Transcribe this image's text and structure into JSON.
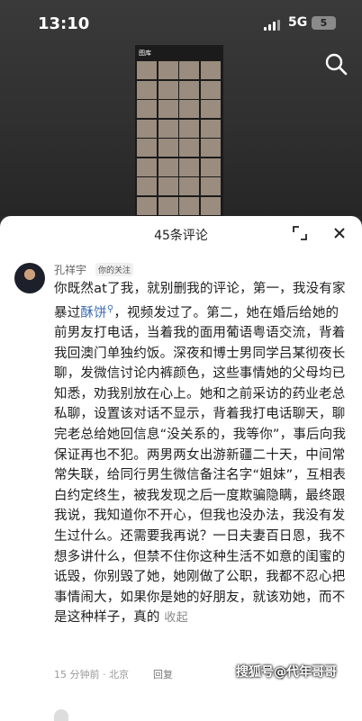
{
  "status_bar": {
    "time": "13:10",
    "network": "5G",
    "battery": "5"
  },
  "video": {
    "gallery_header": "图库"
  },
  "comments_sheet": {
    "title": "45条评论"
  },
  "comment": {
    "username": "孔祥宇",
    "relation_badge": "你的关注",
    "text_before_mention": "你既然at了我，就别删我的评论，第一，我没有家暴过",
    "mention": "酥饼",
    "text_after_mention": "，视频发过了。第二，她在婚后给她的前男友打电话，当着我的面用葡语粤语交流，背着我回澳门单独约饭。深夜和博士男同学吕某彻夜长聊，发微信讨论内裤颜色，这些事情她的父母均已知悉，劝我别放在心上。她和之前采访的药业老总私聊，设置该对话不显示，背着我打电话聊天，聊完老总给她回信息“没关系的，我等你”，事后向我保证再也不犯。两男两女出游新疆二十天，中间常常失联，给同行男生微信备注名字“姐妹”，互相表白约定终生，被我发现之后一度欺骗隐瞒，最终跟我说，我知道你不开心，但我也没办法，我没有发生过什么。还需要我再说？一日夫妻百日恩，我不想多讲什么，但禁不住你这种生活不如意的闺蜜的诋毁，你别毁了她，她刚做了公职，我都不忍心把事情闹大，如果你是她的好朋友，就该劝她，而不是这种样子，真的 ",
    "collapse_label": "收起",
    "time_location": "15 分钟前 · 北京",
    "reply_label": "回复"
  },
  "watermark": "搜狐号@代年哥哥",
  "icons": {
    "search": "search-icon",
    "expand": "expand-icon",
    "close": "close-icon",
    "like": "heart-icon"
  }
}
